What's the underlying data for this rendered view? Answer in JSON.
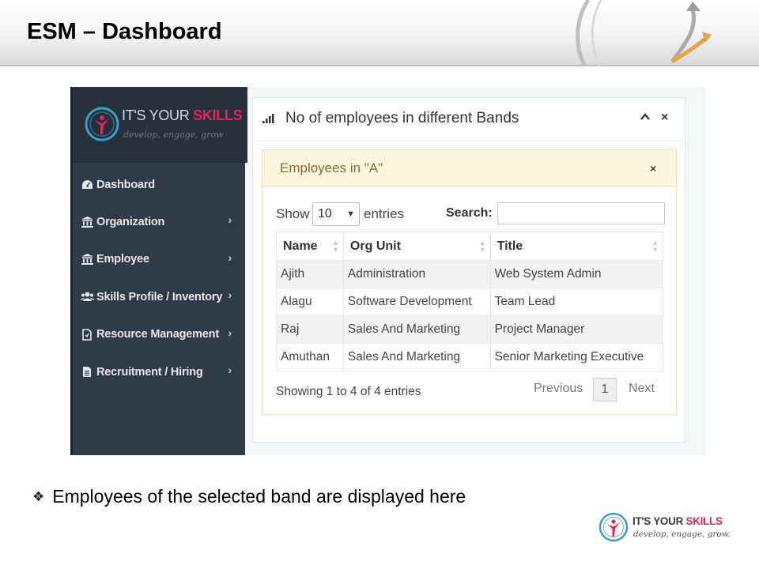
{
  "slide": {
    "title": "ESM – Dashboard",
    "bullet_text": "Employees  of  the selected band are displayed here"
  },
  "brand": {
    "name_part1": "IT'S YOUR ",
    "name_part2": "SKILLS",
    "tagline": "develop, engage, grow"
  },
  "footer_logo": {
    "name_part1": "IT'S YOUR ",
    "name_part2": "SKILLS",
    "tagline": "develop, engage, grow."
  },
  "sidebar": {
    "items": [
      {
        "label": "Dashboard",
        "icon": "dashboard-icon",
        "has_submenu": false
      },
      {
        "label": "Organization",
        "icon": "bank-icon",
        "has_submenu": true
      },
      {
        "label": "Employee",
        "icon": "bank-icon",
        "has_submenu": true
      },
      {
        "label": "Skills Profile / Inventory",
        "icon": "users-icon",
        "has_submenu": true
      },
      {
        "label": "Resource Management",
        "icon": "document-icon",
        "has_submenu": true
      },
      {
        "label": "Recruitment / Hiring",
        "icon": "file-text-icon",
        "has_submenu": true
      }
    ]
  },
  "panel": {
    "title": "No of employees in different Bands",
    "collapse_symbol": "^",
    "close_symbol": "×"
  },
  "inner_panel": {
    "title": "Employees in \"A\"",
    "close_symbol": "×"
  },
  "table_controls": {
    "show_label": "Show",
    "page_size": "10",
    "entries_label": "entries",
    "search_label": "Search:",
    "search_value": ""
  },
  "table": {
    "columns": [
      "Name",
      "Org Unit",
      "Title"
    ],
    "rows": [
      [
        "Ajith",
        "Administration",
        "Web System Admin"
      ],
      [
        "Alagu",
        "Software Development",
        "Team Lead"
      ],
      [
        "Raj",
        "Sales And Marketing",
        "Project Manager"
      ],
      [
        "Amuthan",
        "Sales And Marketing",
        "Senior Marketing Executive"
      ]
    ]
  },
  "pagination": {
    "info": "Showing 1 to 4 of 4 entries",
    "previous_label": "Previous",
    "current_page": "1",
    "next_label": "Next"
  },
  "colors": {
    "sidebar_bg": "#2f3b47",
    "brand_accent": "#e3245e",
    "inner_header_bg": "#fcf6de",
    "inner_title": "#8a6a2d"
  }
}
